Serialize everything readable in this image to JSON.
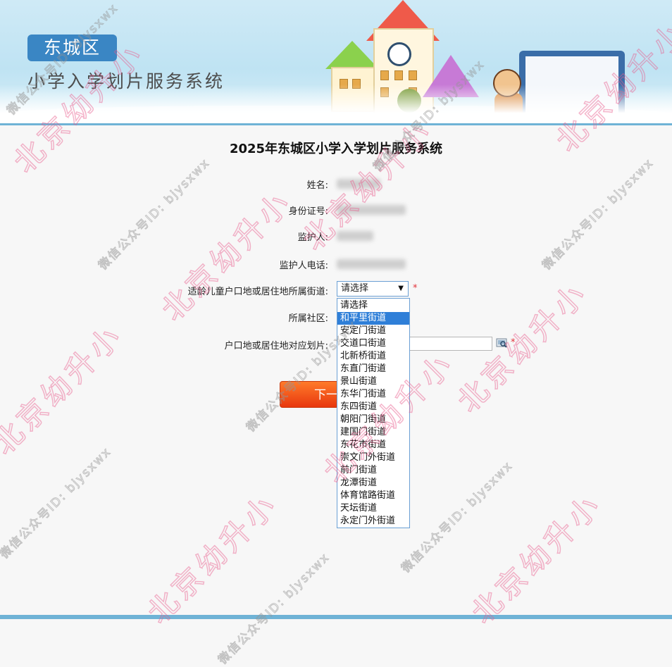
{
  "header": {
    "district": "东城区",
    "system_name": "小学入学划片服务系统"
  },
  "form": {
    "title": "2025年东城区小学入学划片服务系统",
    "fields": {
      "name": {
        "label": "姓名:"
      },
      "id_number": {
        "label": "身份证号:"
      },
      "guardian": {
        "label": "监护人:"
      },
      "guardian_phone": {
        "label": "监护人电话:"
      },
      "street": {
        "label": "适龄儿童户口地或居住地所属街道:",
        "selected": "请选择",
        "required_mark": "*"
      },
      "community": {
        "label": "所属社区:"
      },
      "zone": {
        "label": "户口地或居住地对应划片:",
        "required_mark": "*"
      }
    },
    "dropdown_options": [
      "请选择",
      "和平里街道",
      "安定门街道",
      "交道口街道",
      "北新桥街道",
      "东直门街道",
      "景山街道",
      "东华门街道",
      "东四街道",
      "朝阳门街道",
      "建国门街道",
      "东花市街道",
      "崇文门外街道",
      "前门街道",
      "龙潭街道",
      "体育馆路街道",
      "天坛街道",
      "永定门外街道"
    ],
    "highlighted_option": "和平里街道",
    "next_button": "下一步"
  },
  "watermark": {
    "big": "北京幼升小",
    "small": "微信公众号ID: bjysxwx"
  },
  "colors": {
    "badge": "#3a86c4",
    "highlight": "#2f7fd8",
    "button": "#e8380e",
    "required": "#e2333a"
  }
}
